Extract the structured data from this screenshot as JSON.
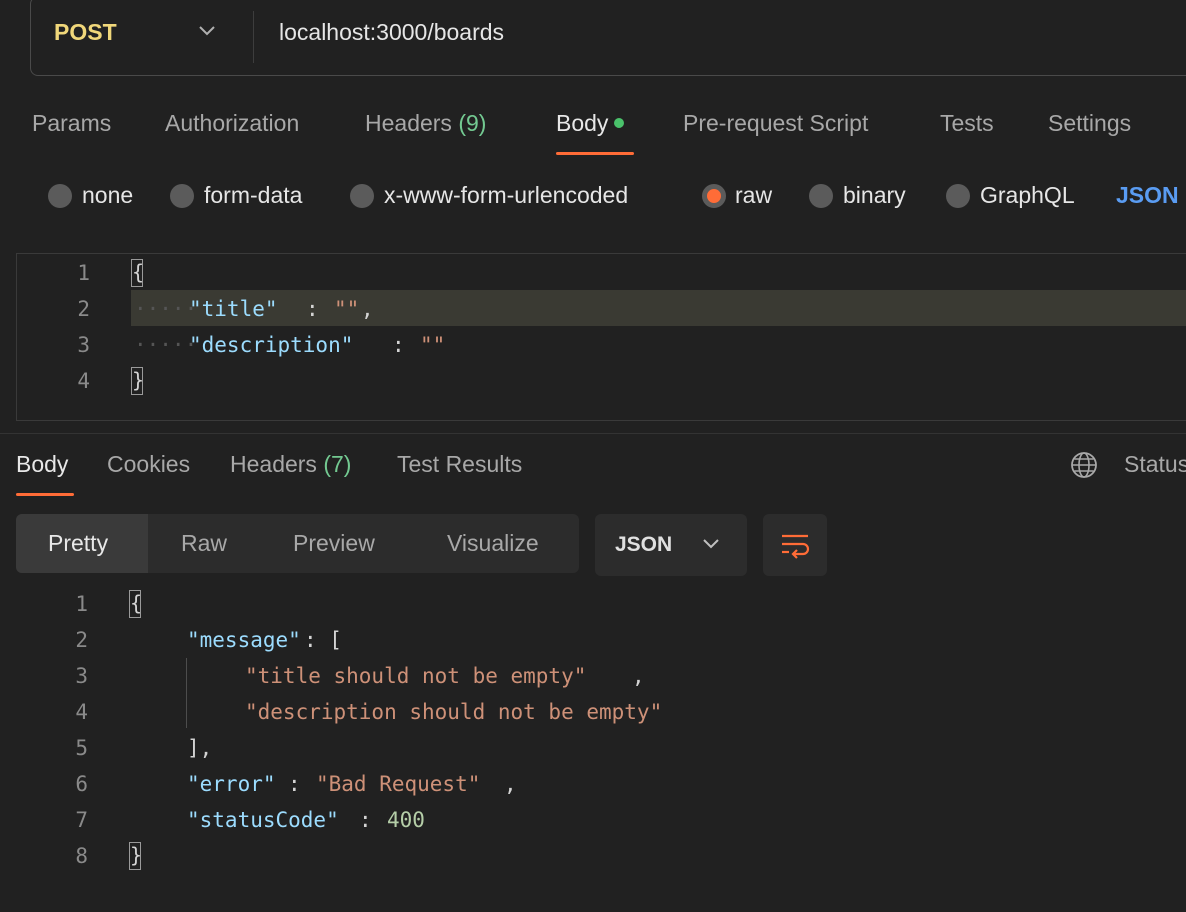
{
  "request": {
    "method": "POST",
    "url": "localhost:3000/boards"
  },
  "request_tabs": {
    "params": "Params",
    "authorization": "Authorization",
    "headers": "Headers",
    "headers_count": "(9)",
    "body": "Body",
    "prerequest": "Pre-request Script",
    "tests": "Tests",
    "settings": "Settings"
  },
  "body_types": {
    "none": "none",
    "form_data": "form-data",
    "urlencoded": "x-www-form-urlencoded",
    "raw": "raw",
    "binary": "binary",
    "graphql": "GraphQL",
    "json": "JSON",
    "selected": "raw"
  },
  "request_body": {
    "line_numbers": [
      "1",
      "2",
      "3",
      "4"
    ],
    "open": "{",
    "close": "}",
    "key_title": "\"title\"",
    "key_description": "\"description\"",
    "empty": "\"\"",
    "colon": ":",
    "comma": ","
  },
  "response_tabs": {
    "body": "Body",
    "cookies": "Cookies",
    "headers": "Headers",
    "headers_count": "(7)",
    "test_results": "Test Results",
    "status": "Status"
  },
  "response_view": {
    "pretty": "Pretty",
    "raw": "Raw",
    "preview": "Preview",
    "visualize": "Visualize",
    "format": "JSON"
  },
  "response_body": {
    "line_numbers": [
      "1",
      "2",
      "3",
      "4",
      "5",
      "6",
      "7",
      "8"
    ],
    "open": "{",
    "close": "}",
    "key_message": "\"message\"",
    "msg_title": "\"title should not be empty\"",
    "msg_description": "\"description should not be empty\"",
    "key_error": "\"error\"",
    "val_error": "\"Bad Request\"",
    "key_status": "\"statusCode\"",
    "val_status": "400"
  },
  "colors": {
    "accent": "#ff6c37",
    "method": "#f0d77a",
    "link": "#5a9cf2",
    "count": "#73c991"
  }
}
